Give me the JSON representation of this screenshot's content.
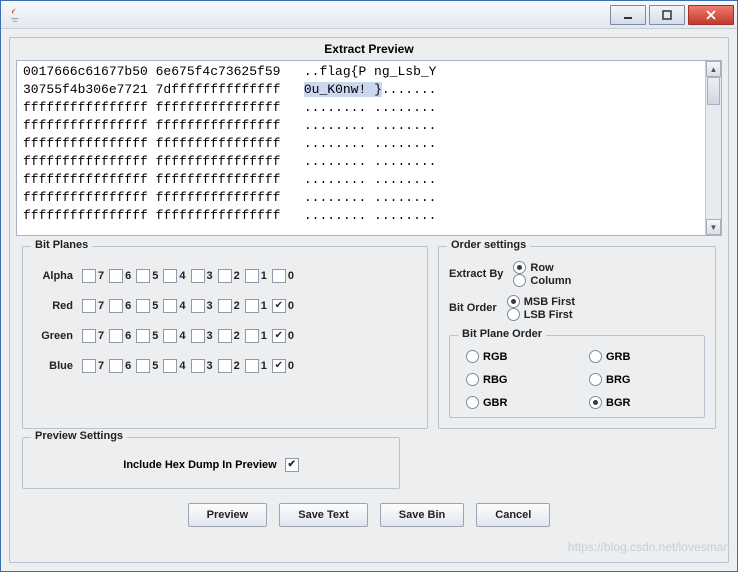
{
  "window": {
    "min_tip": "Minimize",
    "max_tip": "Maximize",
    "close_tip": "Close"
  },
  "header": {
    "title": "Extract Preview"
  },
  "hex": {
    "lines": [
      {
        "col1": "0017666c61677b50",
        "col2": "6e675f4c73625f59",
        "ascii": "..flag{P ng_Lsb_Y"
      },
      {
        "col1": "30755f4b306e7721",
        "col2": "7dffffffffffffff",
        "ascii_pre": "",
        "ascii_hl": "0u_K0nw! }",
        "ascii_post": "......."
      },
      {
        "col1": "ffffffffffffffff",
        "col2": "ffffffffffffffff",
        "ascii": "........ ........"
      },
      {
        "col1": "ffffffffffffffff",
        "col2": "ffffffffffffffff",
        "ascii": "........ ........"
      },
      {
        "col1": "ffffffffffffffff",
        "col2": "ffffffffffffffff",
        "ascii": "........ ........"
      },
      {
        "col1": "ffffffffffffffff",
        "col2": "ffffffffffffffff",
        "ascii": "........ ........"
      },
      {
        "col1": "ffffffffffffffff",
        "col2": "ffffffffffffffff",
        "ascii": "........ ........"
      },
      {
        "col1": "ffffffffffffffff",
        "col2": "ffffffffffffffff",
        "ascii": "........ ........"
      },
      {
        "col1": "ffffffffffffffff",
        "col2": "ffffffffffffffff",
        "ascii": "........ ........"
      }
    ]
  },
  "bitplanes": {
    "legend": "Bit Planes",
    "bits": [
      "7",
      "6",
      "5",
      "4",
      "3",
      "2",
      "1",
      "0"
    ],
    "channels": [
      {
        "name": "Alpha",
        "checked": [
          false,
          false,
          false,
          false,
          false,
          false,
          false,
          false
        ]
      },
      {
        "name": "Red",
        "checked": [
          false,
          false,
          false,
          false,
          false,
          false,
          false,
          true
        ]
      },
      {
        "name": "Green",
        "checked": [
          false,
          false,
          false,
          false,
          false,
          false,
          false,
          true
        ]
      },
      {
        "name": "Blue",
        "checked": [
          false,
          false,
          false,
          false,
          false,
          false,
          false,
          true
        ]
      }
    ]
  },
  "order": {
    "legend": "Order settings",
    "extract_by_label": "Extract By",
    "extract_by_options": [
      "Row",
      "Column"
    ],
    "extract_by_selected": "Row",
    "bit_order_label": "Bit Order",
    "bit_order_options": [
      "MSB First",
      "LSB First"
    ],
    "bit_order_selected": "MSB First",
    "plane_legend": "Bit Plane Order",
    "plane_options": [
      "RGB",
      "GRB",
      "RBG",
      "BRG",
      "GBR",
      "BGR"
    ],
    "plane_selected": "BGR"
  },
  "preview_settings": {
    "legend": "Preview Settings",
    "include_hex_label": "Include Hex Dump In Preview",
    "include_hex_checked": true
  },
  "buttons": {
    "preview": "Preview",
    "save_text": "Save Text",
    "save_bin": "Save Bin",
    "cancel": "Cancel"
  },
  "watermark": "https://blog.csdn.net/lovesman"
}
